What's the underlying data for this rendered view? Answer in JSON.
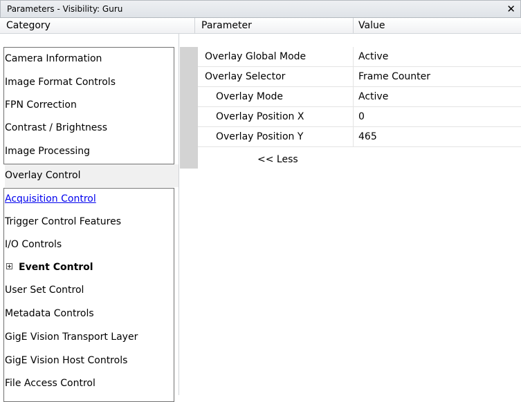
{
  "window": {
    "title": "Parameters - Visibility: Guru",
    "close_glyph": "✕"
  },
  "header": {
    "category": "Category",
    "parameter": "Parameter",
    "value": "Value"
  },
  "categories": [
    "Camera Information",
    "Image Format Controls",
    "FPN Correction",
    "Contrast / Brightness",
    "Image Processing",
    "Overlay Control",
    "Acquisition Control",
    "Trigger Control Features",
    "I/O Controls",
    "Event Control",
    "User Set Control",
    "Metadata Controls",
    "GigE Vision Transport Layer",
    "GigE Vision Host Controls",
    "File Access Control"
  ],
  "params": [
    {
      "name": "Overlay Global Mode",
      "value": "Active"
    },
    {
      "name": "Overlay Selector",
      "value": "Frame Counter"
    },
    {
      "name": "Overlay Mode",
      "value": "Active"
    },
    {
      "name": "Overlay Position X",
      "value": "0"
    },
    {
      "name": "Overlay Position Y",
      "value": "465"
    }
  ],
  "less_label": "<< Less",
  "selected_category": "Overlay Control",
  "link_category": "Acquisition Control",
  "expandable_category": "Event Control"
}
